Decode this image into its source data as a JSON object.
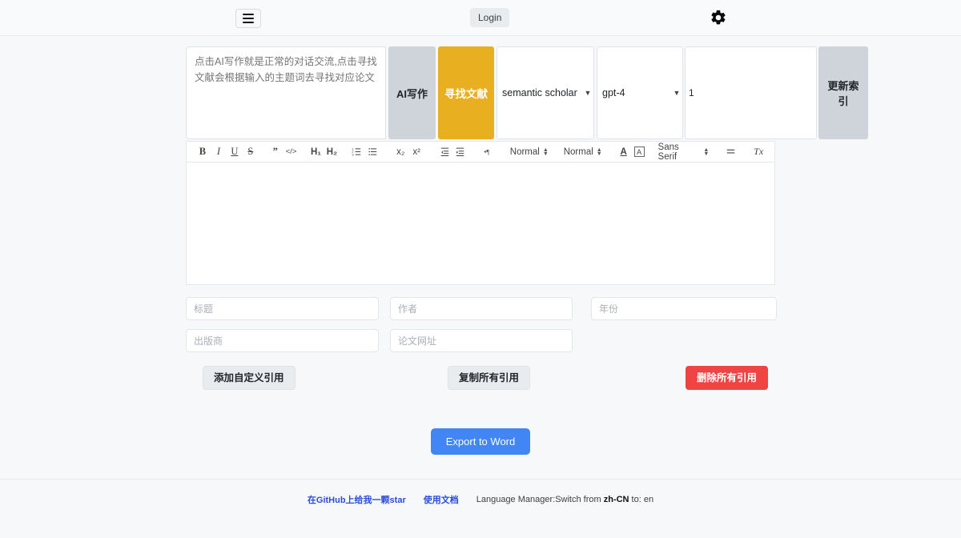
{
  "header": {
    "menu_icon": "hamburger-icon",
    "login_label": "Login",
    "settings_icon": "gear-icon"
  },
  "toolbar": {
    "prompt_placeholder": "点击AI写作就是正常的对话交流,点击寻找文献会根据输入的主题词去寻找对应论文",
    "ai_write_label": "AI写作",
    "find_literature_label": "寻找文献",
    "source_selected": "semantic scholar",
    "source_options": [
      "semantic scholar"
    ],
    "model_selected": "gpt-4",
    "model_options": [
      "gpt-4"
    ],
    "count_value": "1",
    "update_index_label": "更新索引"
  },
  "editor": {
    "bold": "B",
    "italic": "I",
    "underline": "U",
    "strike": "S",
    "blockquote": "”",
    "code_block": "</>",
    "header1": "H₁",
    "header2": "H₂",
    "list_ordered": "list-ordered-icon",
    "list_bullet": "list-bullet-icon",
    "subscript": "x₂",
    "superscript": "x²",
    "outdent": "outdent-icon",
    "indent": "indent-icon",
    "direction": "direction-icon",
    "size_label": "Normal",
    "header_label": "Normal",
    "color": "A",
    "background": "A",
    "font_label": "Sans Serif",
    "align": "align-icon",
    "clean": "Tx",
    "content": ""
  },
  "citation": {
    "title_placeholder": "标题",
    "author_placeholder": "作者",
    "year_placeholder": "年份",
    "publisher_placeholder": "出版商",
    "url_placeholder": "论文网址",
    "title_value": "",
    "author_value": "",
    "year_value": "",
    "publisher_value": "",
    "url_value": "",
    "add_custom_label": "添加自定义引用",
    "copy_all_label": "复制所有引用",
    "delete_all_label": "删除所有引用"
  },
  "export": {
    "label": "Export to Word"
  },
  "footer": {
    "github_label": "在GitHub上给我一颗star",
    "docs_label": "使用文档",
    "language_prefix": "Language Manager:Switch from ",
    "language_current": "zh-CN",
    "language_middle": " to: ",
    "language_target": "en"
  },
  "colors": {
    "accent_blue": "#4285f4",
    "amber": "#e8b021",
    "danger_red": "#ef4444",
    "gray_btn": "#ced4da",
    "page_bg": "#f6f8fa"
  }
}
